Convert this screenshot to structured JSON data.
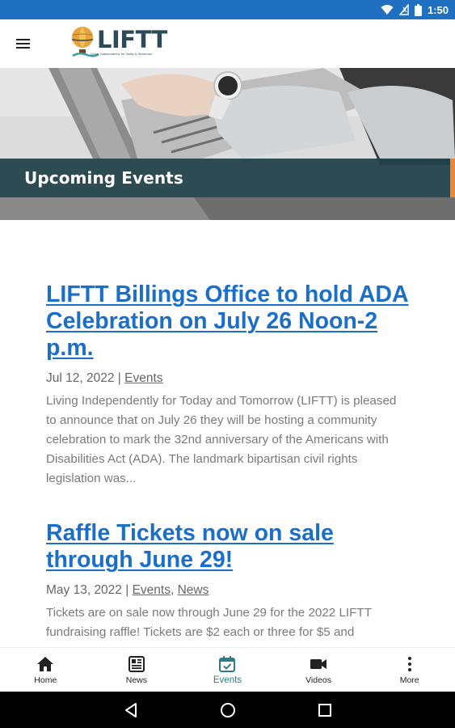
{
  "status_bar": {
    "time": "1:50",
    "icons": [
      "wifi-icon",
      "signal-icon",
      "battery-icon"
    ]
  },
  "header": {
    "menu_icon": "hamburger-menu-icon",
    "logo_text": "LIFTT",
    "logo_tagline": "Living Independently for Today & Tomorrow",
    "logo_icon": "hot-air-balloon-icon"
  },
  "hero": {
    "title": "Upcoming Events",
    "band_color": "#21424a",
    "accent_color": "#e8883a"
  },
  "posts": [
    {
      "title": "LIFTT Billings Office to hold ADA Celebration on July 26 Noon-2 p.m.",
      "date": "Jul 12, 2022",
      "separator": " | ",
      "categories": [
        "Events"
      ],
      "excerpt": "Living Independently for Today and Tomorrow (LIFTT) is pleased to announce that on July 26 they will be hosting a community celebration to mark the 32nd anniversary of the Americans with Disabilities Act (ADA). The landmark bipartisan civil rights legislation was..."
    },
    {
      "title": "Raffle Tickets now on sale through June 29!",
      "date": "May 13, 2022",
      "separator": " | ",
      "categories": [
        "Events",
        "News"
      ],
      "category_separator": ", ",
      "excerpt": "Tickets are on sale now through June 29 for the 2022 LIFTT fundraising raffle! Tickets are $2 each or three for $5 and"
    }
  ],
  "bottom_nav": {
    "items": [
      {
        "label": "Home",
        "icon": "home-icon"
      },
      {
        "label": "News",
        "icon": "newspaper-icon"
      },
      {
        "label": "Events",
        "icon": "calendar-check-icon",
        "active": true
      },
      {
        "label": "Videos",
        "icon": "video-camera-icon"
      },
      {
        "label": "More",
        "icon": "more-vertical-icon"
      }
    ],
    "active_color": "#2e7d86"
  },
  "system_nav": {
    "buttons": [
      "back-icon",
      "home-circle-icon",
      "recents-icon"
    ]
  },
  "colors": {
    "status_bar": "#1f70c1",
    "link": "#1b6fc8",
    "meta_text": "#666666",
    "body_text": "#7a7a7a"
  }
}
